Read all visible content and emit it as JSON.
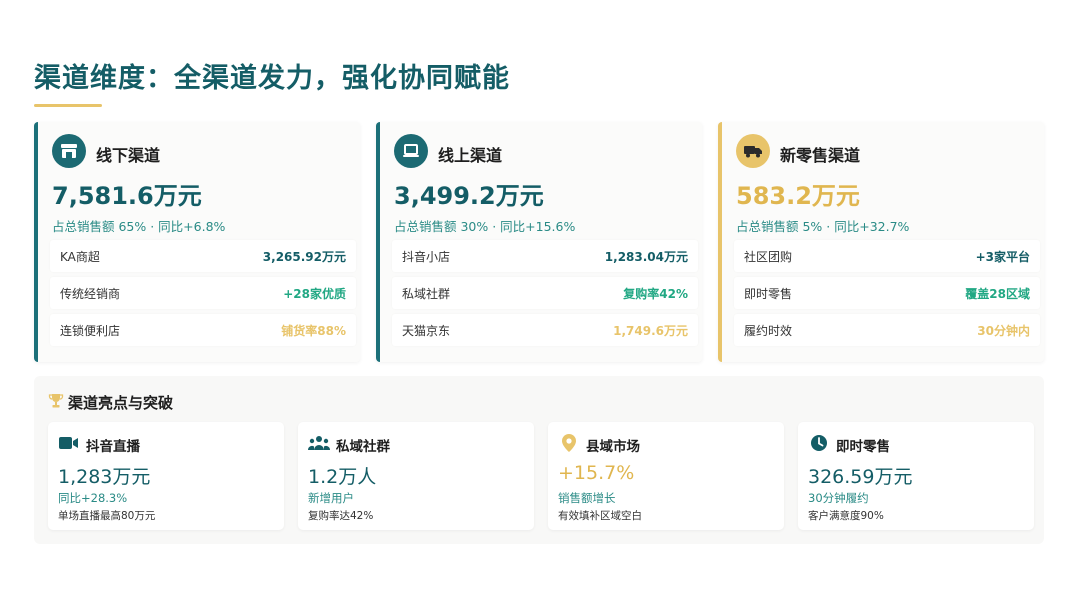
{
  "page": {
    "title": "渠道维度：全渠道发力，强化协同赋能"
  },
  "colors": {
    "teal": "#145d66",
    "teal_icon": "#1c6a73",
    "gold": "#e8c46a",
    "green": "#22a884",
    "sub_teal": "#2a8b86"
  },
  "channels": [
    {
      "icon": "store-icon",
      "name": "线下渠道",
      "amount": "7,581.6万元",
      "sub": "占总销售额 65% · 同比+6.8%",
      "rows": [
        {
          "label": "KA商超",
          "value": "3,265.92万元"
        },
        {
          "label": "传统经销商",
          "value": "+28家优质"
        },
        {
          "label": "连锁便利店",
          "value": "铺货率88%"
        }
      ]
    },
    {
      "icon": "laptop-icon",
      "name": "线上渠道",
      "amount": "3,499.2万元",
      "sub": "占总销售额 30% · 同比+15.6%",
      "rows": [
        {
          "label": "抖音小店",
          "value": "1,283.04万元"
        },
        {
          "label": "私域社群",
          "value": "复购率42%"
        },
        {
          "label": "天猫京东",
          "value": "1,749.6万元"
        }
      ]
    },
    {
      "icon": "truck-icon",
      "name": "新零售渠道",
      "amount": "583.2万元",
      "sub": "占总销售额 5% · 同比+32.7%",
      "rows": [
        {
          "label": "社区团购",
          "value": "+3家平台"
        },
        {
          "label": "即时零售",
          "value": "覆盖28区域"
        },
        {
          "label": "履约时效",
          "value": "30分钟内"
        }
      ]
    }
  ],
  "highlights": {
    "title": "渠道亮点与突破",
    "items": [
      {
        "icon": "video-camera-icon",
        "name": "抖音直播",
        "amount": "1,283万元",
        "sub": "同比+28.3%",
        "note": "单场直播最高80万元"
      },
      {
        "icon": "users-icon",
        "name": "私域社群",
        "amount": "1.2万人",
        "sub": "新增用户",
        "note": "复购率达42%"
      },
      {
        "icon": "map-pin-icon",
        "name": "县域市场",
        "amount": "+15.7%",
        "sub": "销售额增长",
        "note": "有效填补区域空白"
      },
      {
        "icon": "clock-icon",
        "name": "即时零售",
        "amount": "326.59万元",
        "sub": "30分钟履约",
        "note": "客户满意度90%"
      }
    ]
  }
}
